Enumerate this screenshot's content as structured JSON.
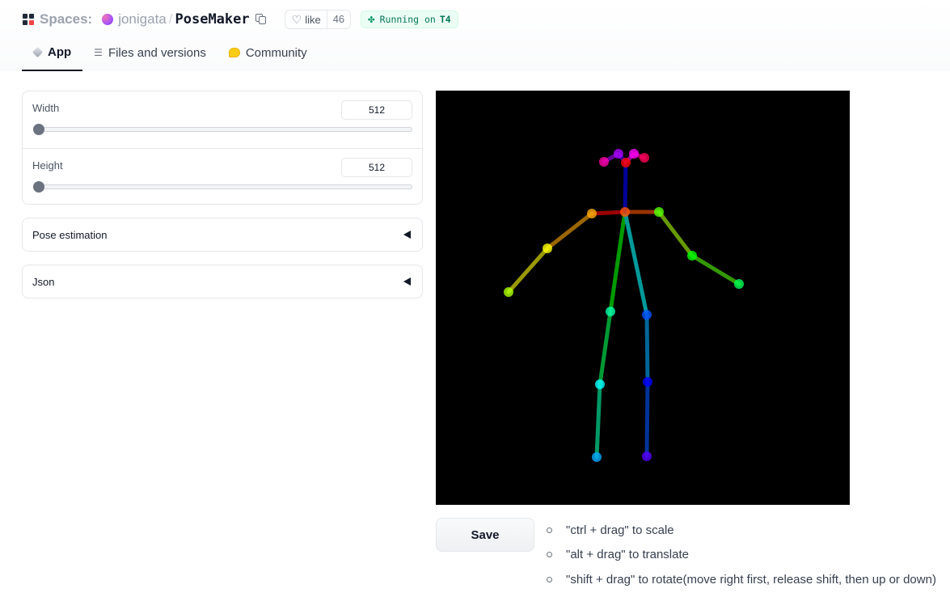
{
  "header": {
    "spaces_label": "Spaces:",
    "owner": "jonigata",
    "separator": "/",
    "repo": "PoseMaker",
    "like_label": "like",
    "like_count": "46",
    "status_prefix": "Running on",
    "status_hardware": "T4",
    "status_color": "#047857"
  },
  "tabs": [
    {
      "label": "App",
      "icon": "cube-icon",
      "active": true
    },
    {
      "label": "Files and versions",
      "icon": "files-icon",
      "active": false
    },
    {
      "label": "Community",
      "icon": "community-icon",
      "active": false
    }
  ],
  "controls": {
    "width": {
      "label": "Width",
      "value": "512"
    },
    "height": {
      "label": "Height",
      "value": "512"
    }
  },
  "accordions": {
    "pose_estimation": "Pose estimation",
    "json": "Json"
  },
  "pose": {
    "keypoints": [
      {
        "name": "nose",
        "color": "#ff0000"
      },
      {
        "name": "neck",
        "color": "#ff5500"
      },
      {
        "name": "right-shoulder",
        "color": "#ffaa00"
      },
      {
        "name": "right-elbow",
        "color": "#ffff00"
      },
      {
        "name": "right-wrist",
        "color": "#aaff00"
      },
      {
        "name": "left-shoulder",
        "color": "#55ff00"
      },
      {
        "name": "left-elbow",
        "color": "#00ff00"
      },
      {
        "name": "left-wrist",
        "color": "#00ff55"
      },
      {
        "name": "right-hip",
        "color": "#00ffaa"
      },
      {
        "name": "right-knee",
        "color": "#00ffff"
      },
      {
        "name": "right-ankle",
        "color": "#00aaff"
      },
      {
        "name": "left-hip",
        "color": "#0055ff"
      },
      {
        "name": "left-knee",
        "color": "#0000ff"
      },
      {
        "name": "left-ankle",
        "color": "#5500ff"
      },
      {
        "name": "right-eye",
        "color": "#aa00ff"
      },
      {
        "name": "left-eye",
        "color": "#ff00ff"
      },
      {
        "name": "right-ear",
        "color": "#ff00aa"
      },
      {
        "name": "left-ear",
        "color": "#ff0055"
      }
    ]
  },
  "save_label": "Save",
  "hints": [
    "\"ctrl + drag\" to scale",
    "\"alt + drag\" to translate",
    "\"shift + drag\" to rotate(move right first, release shift, then up or down)"
  ]
}
